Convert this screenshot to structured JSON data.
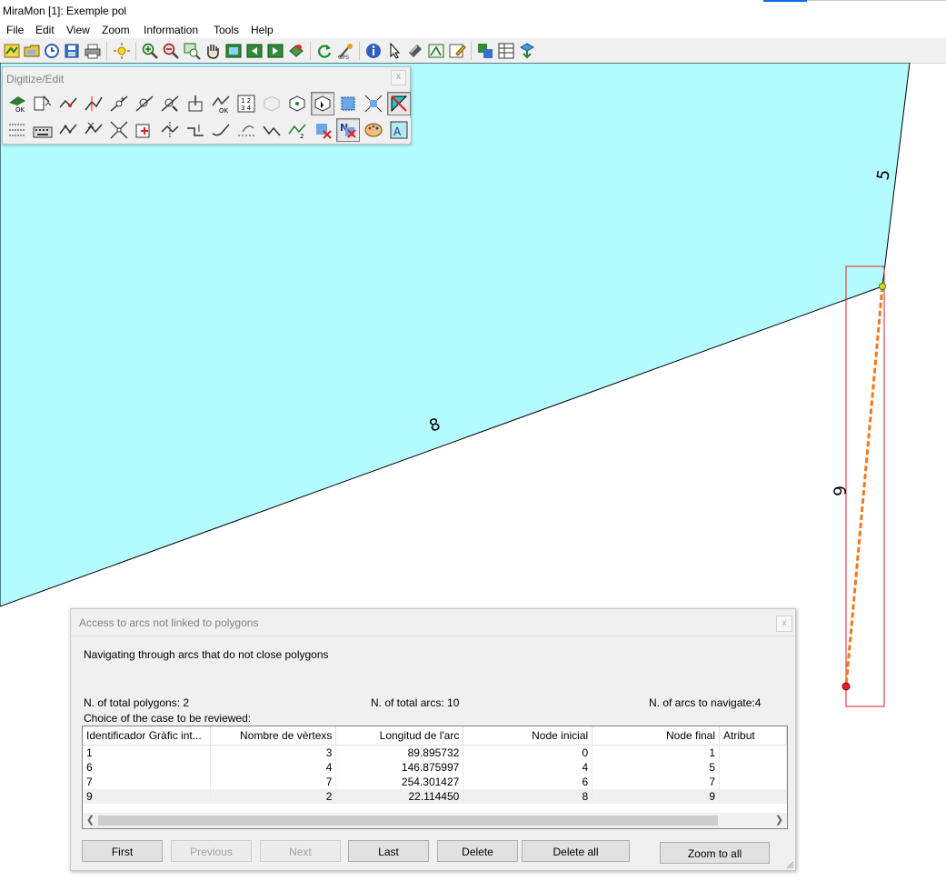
{
  "window": {
    "title": "MiraMon [1]:  Exemple pol"
  },
  "menu": {
    "items": [
      "File",
      "Edit",
      "View",
      "Zoom",
      "Information",
      "Tools",
      "Help"
    ]
  },
  "toolbar": {
    "buttons": [
      "new-map-icon",
      "open-file-icon",
      "history-icon",
      "save-icon",
      "print-icon",
      "sun-icon",
      "zoom-in-icon",
      "zoom-out-icon",
      "zoom-window-icon",
      "pan-hand-icon",
      "view-all-icon",
      "previous-view-icon",
      "next-view-icon",
      "layers-icon",
      "refresh-icon",
      "coordinates-icon",
      "info-icon",
      "pointer-icon",
      "measure-icon",
      "edit-layer-icon",
      "draw-icon",
      "export-icon",
      "table-icon",
      "download-icon"
    ]
  },
  "digitize": {
    "title": "Digitize/Edit",
    "close_label": "x",
    "ok_label": "OK"
  },
  "map": {
    "fill_color": "#b3fbff",
    "arc_labels": [
      "5",
      "8",
      "9"
    ],
    "highlight_color": "#d52020",
    "arc_color": "#f07820"
  },
  "dialog": {
    "title": "Access to arcs not linked to polygons",
    "close_label": "x",
    "heading": "Navigating through arcs that do not close polygons",
    "total_polygons": "N. of total polygons: 2",
    "total_arcs": "N. of total arcs: 10",
    "arcs_to_navigate": "N. of arcs to navigate:4",
    "choice_label": "Choice of the case to be reviewed:",
    "table": {
      "headers": [
        "Identificador Gràfic int...",
        "Nombre de vèrtexs",
        "Longitud de l'arc",
        "Node inicial",
        "Node final",
        "Atribut"
      ],
      "rows": [
        [
          "1",
          "3",
          "89.895732",
          "0",
          "1",
          ""
        ],
        [
          "6",
          "4",
          "146.875997",
          "4",
          "5",
          ""
        ],
        [
          "7",
          "7",
          "254.301427",
          "6",
          "7",
          ""
        ],
        [
          "9",
          "2",
          "22.114450",
          "8",
          "9",
          ""
        ]
      ],
      "selected_row": 3
    },
    "buttons": {
      "first": "First",
      "previous": "Previous",
      "next": "Next",
      "last": "Last",
      "delete": "Delete",
      "delete_all": "Delete all",
      "zoom_to_all": "Zoom to all"
    }
  }
}
